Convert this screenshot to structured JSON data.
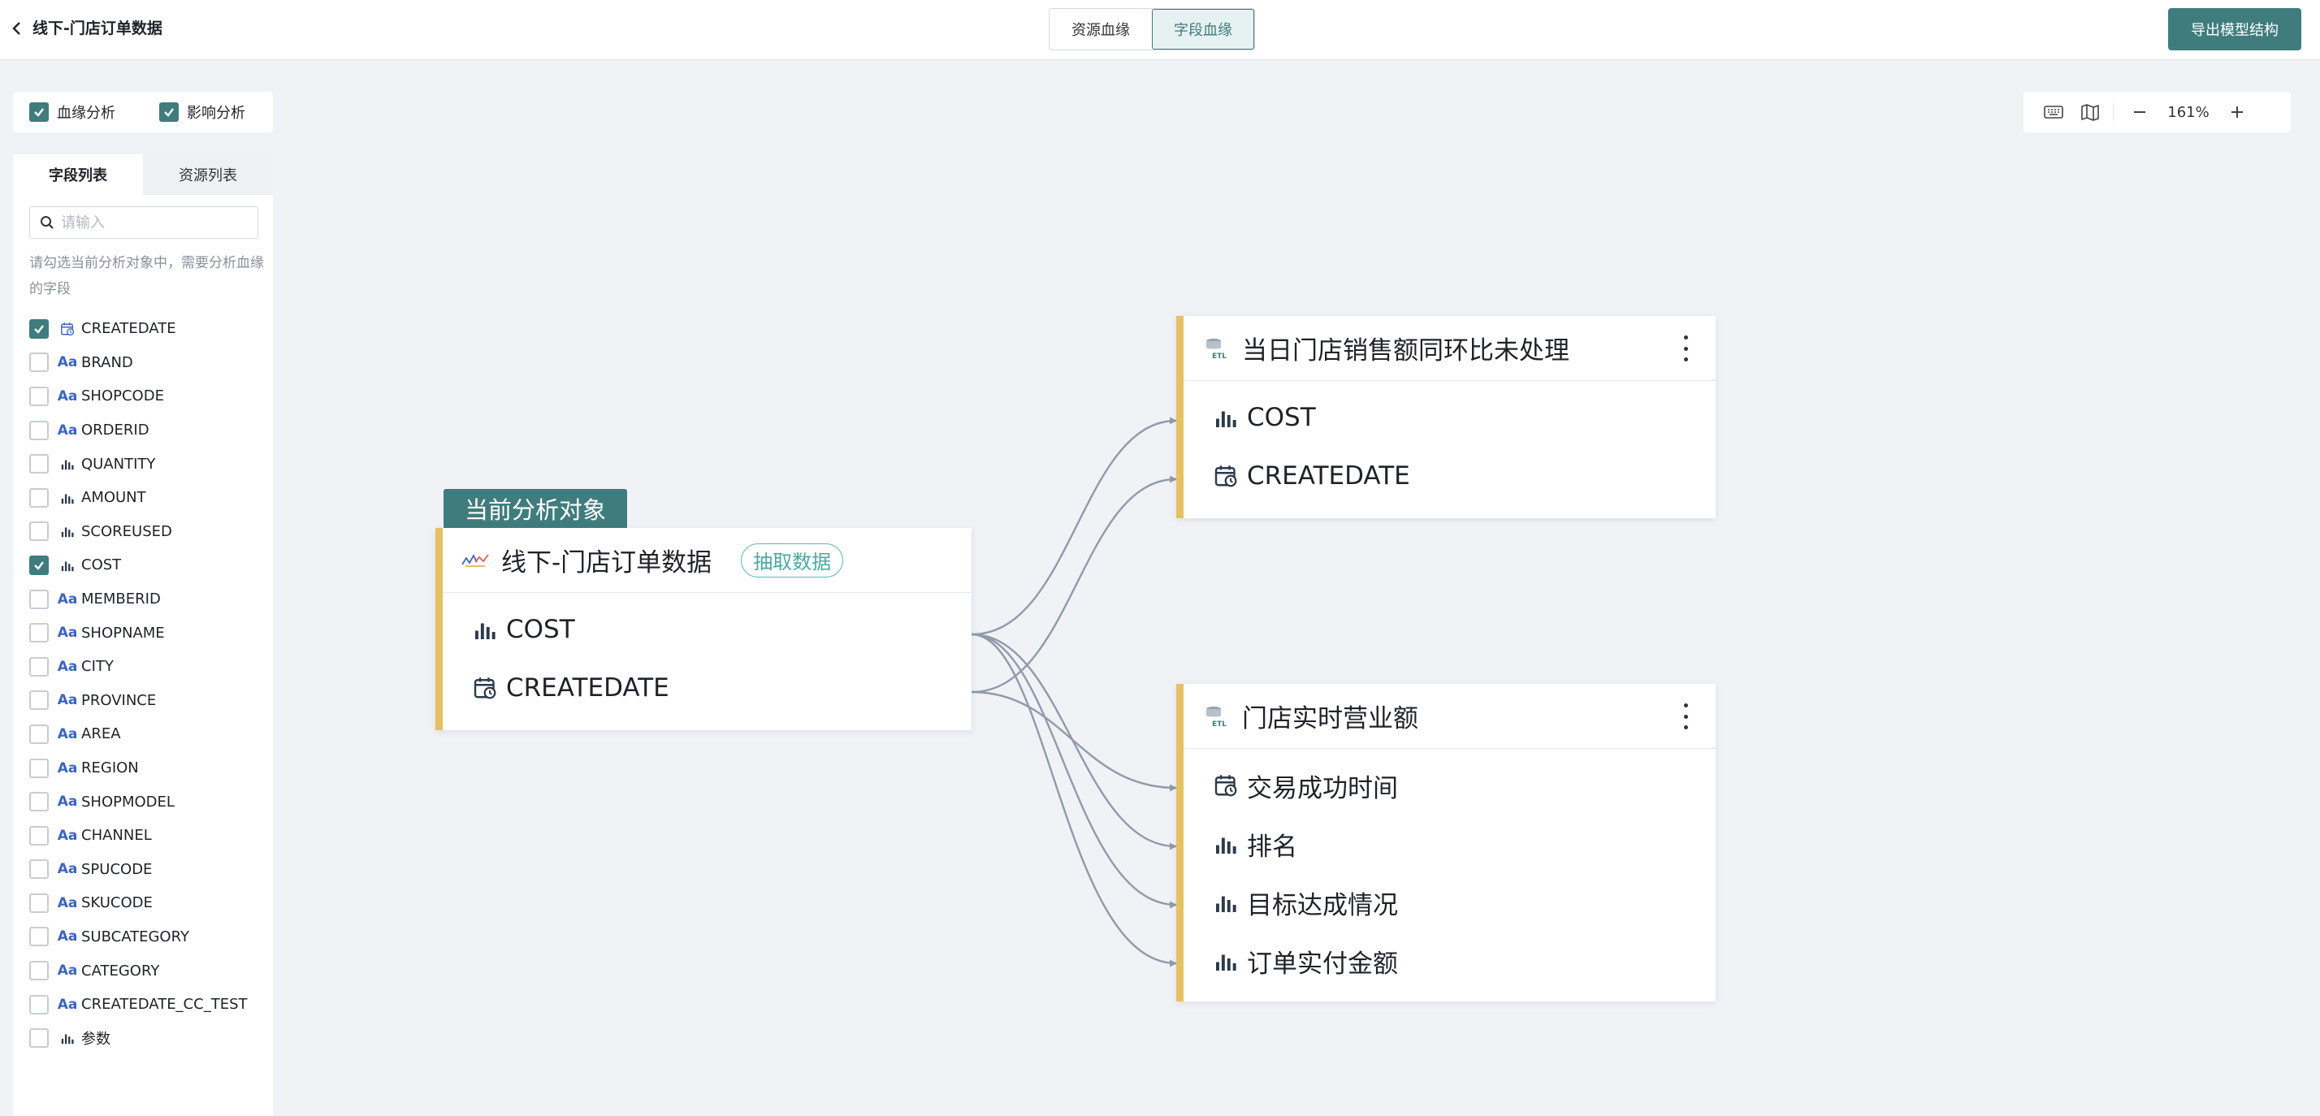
{
  "header": {
    "title": "线下-门店订单数据",
    "tabs": [
      {
        "label": "资源血缘",
        "active": false
      },
      {
        "label": "字段血缘",
        "active": true
      }
    ],
    "export_label": "导出模型结构"
  },
  "analysis_options": [
    {
      "label": "血缘分析",
      "checked": true
    },
    {
      "label": "影响分析",
      "checked": true
    }
  ],
  "sidebar": {
    "tabs": [
      {
        "label": "字段列表",
        "active": true
      },
      {
        "label": "资源列表",
        "active": false
      }
    ],
    "search_placeholder": "请输入",
    "hint": "请勾选当前分析对象中，需要分析血缘的字段",
    "fields": [
      {
        "name": "CREATEDATE",
        "type": "date",
        "checked": true
      },
      {
        "name": "BRAND",
        "type": "text",
        "checked": false
      },
      {
        "name": "SHOPCODE",
        "type": "text",
        "checked": false
      },
      {
        "name": "ORDERID",
        "type": "text",
        "checked": false
      },
      {
        "name": "QUANTITY",
        "type": "measure",
        "checked": false
      },
      {
        "name": "AMOUNT",
        "type": "measure",
        "checked": false
      },
      {
        "name": "SCOREUSED",
        "type": "measure",
        "checked": false
      },
      {
        "name": "COST",
        "type": "measure",
        "checked": true
      },
      {
        "name": "MEMBERID",
        "type": "text",
        "checked": false
      },
      {
        "name": "SHOPNAME",
        "type": "text",
        "checked": false
      },
      {
        "name": "CITY",
        "type": "text",
        "checked": false
      },
      {
        "name": "PROVINCE",
        "type": "text",
        "checked": false
      },
      {
        "name": "AREA",
        "type": "text",
        "checked": false
      },
      {
        "name": "REGION",
        "type": "text",
        "checked": false
      },
      {
        "name": "SHOPMODEL",
        "type": "text",
        "checked": false
      },
      {
        "name": "CHANNEL",
        "type": "text",
        "checked": false
      },
      {
        "name": "SPUCODE",
        "type": "text",
        "checked": false
      },
      {
        "name": "SKUCODE",
        "type": "text",
        "checked": false
      },
      {
        "name": "SUBCATEGORY",
        "type": "text",
        "checked": false
      },
      {
        "name": "CATEGORY",
        "type": "text",
        "checked": false
      },
      {
        "name": "CREATEDATE_CC_TEST",
        "type": "text",
        "checked": false
      },
      {
        "name": "参数",
        "type": "measure",
        "checked": false
      }
    ]
  },
  "zoom": {
    "value": "161%"
  },
  "graph": {
    "current_tag": "当前分析对象",
    "source": {
      "title": "线下-门店订单数据",
      "badge": "抽取数据",
      "fields": [
        {
          "name": "COST",
          "type": "measure"
        },
        {
          "name": "CREATEDATE",
          "type": "date"
        }
      ]
    },
    "targets": [
      {
        "title": "当日门店销售额同环比未处理",
        "icon": "etl-icon",
        "fields": [
          {
            "name": "COST",
            "type": "measure"
          },
          {
            "name": "CREATEDATE",
            "type": "date"
          }
        ]
      },
      {
        "title": "门店实时营业额",
        "icon": "etl-icon",
        "fields": [
          {
            "name": "交易成功时间",
            "type": "date"
          },
          {
            "name": "排名",
            "type": "measure"
          },
          {
            "name": "目标达成情况",
            "type": "measure"
          },
          {
            "name": "订单实付金额",
            "type": "measure"
          }
        ]
      }
    ]
  },
  "colors": {
    "primary": "#3f7c7d",
    "node_accent": "#e7c15e",
    "badge": "#5eb7b1",
    "link": "#8f9bab"
  }
}
